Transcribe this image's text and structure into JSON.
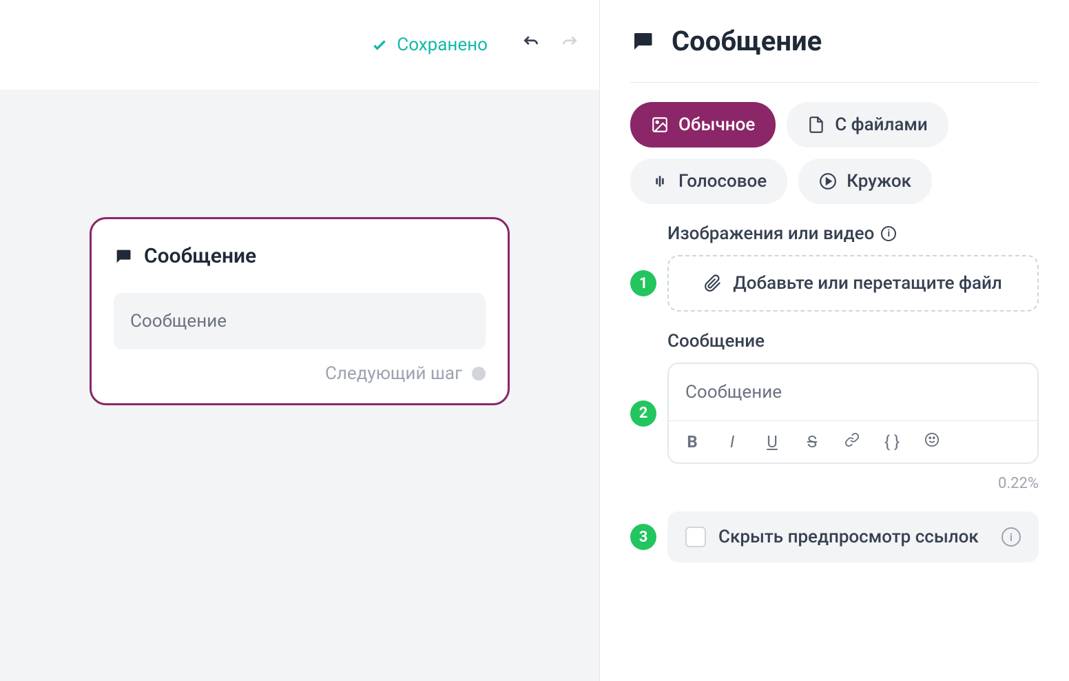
{
  "toolbar": {
    "saved_label": "Сохранено"
  },
  "canvas": {
    "card_title": "Сообщение",
    "message_placeholder": "Сообщение",
    "next_step_label": "Следующий шаг"
  },
  "panel": {
    "title": "Сообщение",
    "tabs": {
      "normal": "Обычное",
      "with_files": "С файлами",
      "voice": "Голосовое",
      "circle": "Кружок"
    },
    "media_section": {
      "label": "Изображения или видео",
      "dropzone_text": "Добавьте или перетащите файл"
    },
    "message_section": {
      "label": "Сообщение",
      "placeholder": "Сообщение",
      "char_count": "0.22%"
    },
    "hide_preview": {
      "label": "Скрыть предпросмотр ссылок"
    },
    "badges": {
      "one": "1",
      "two": "2",
      "three": "3"
    }
  }
}
